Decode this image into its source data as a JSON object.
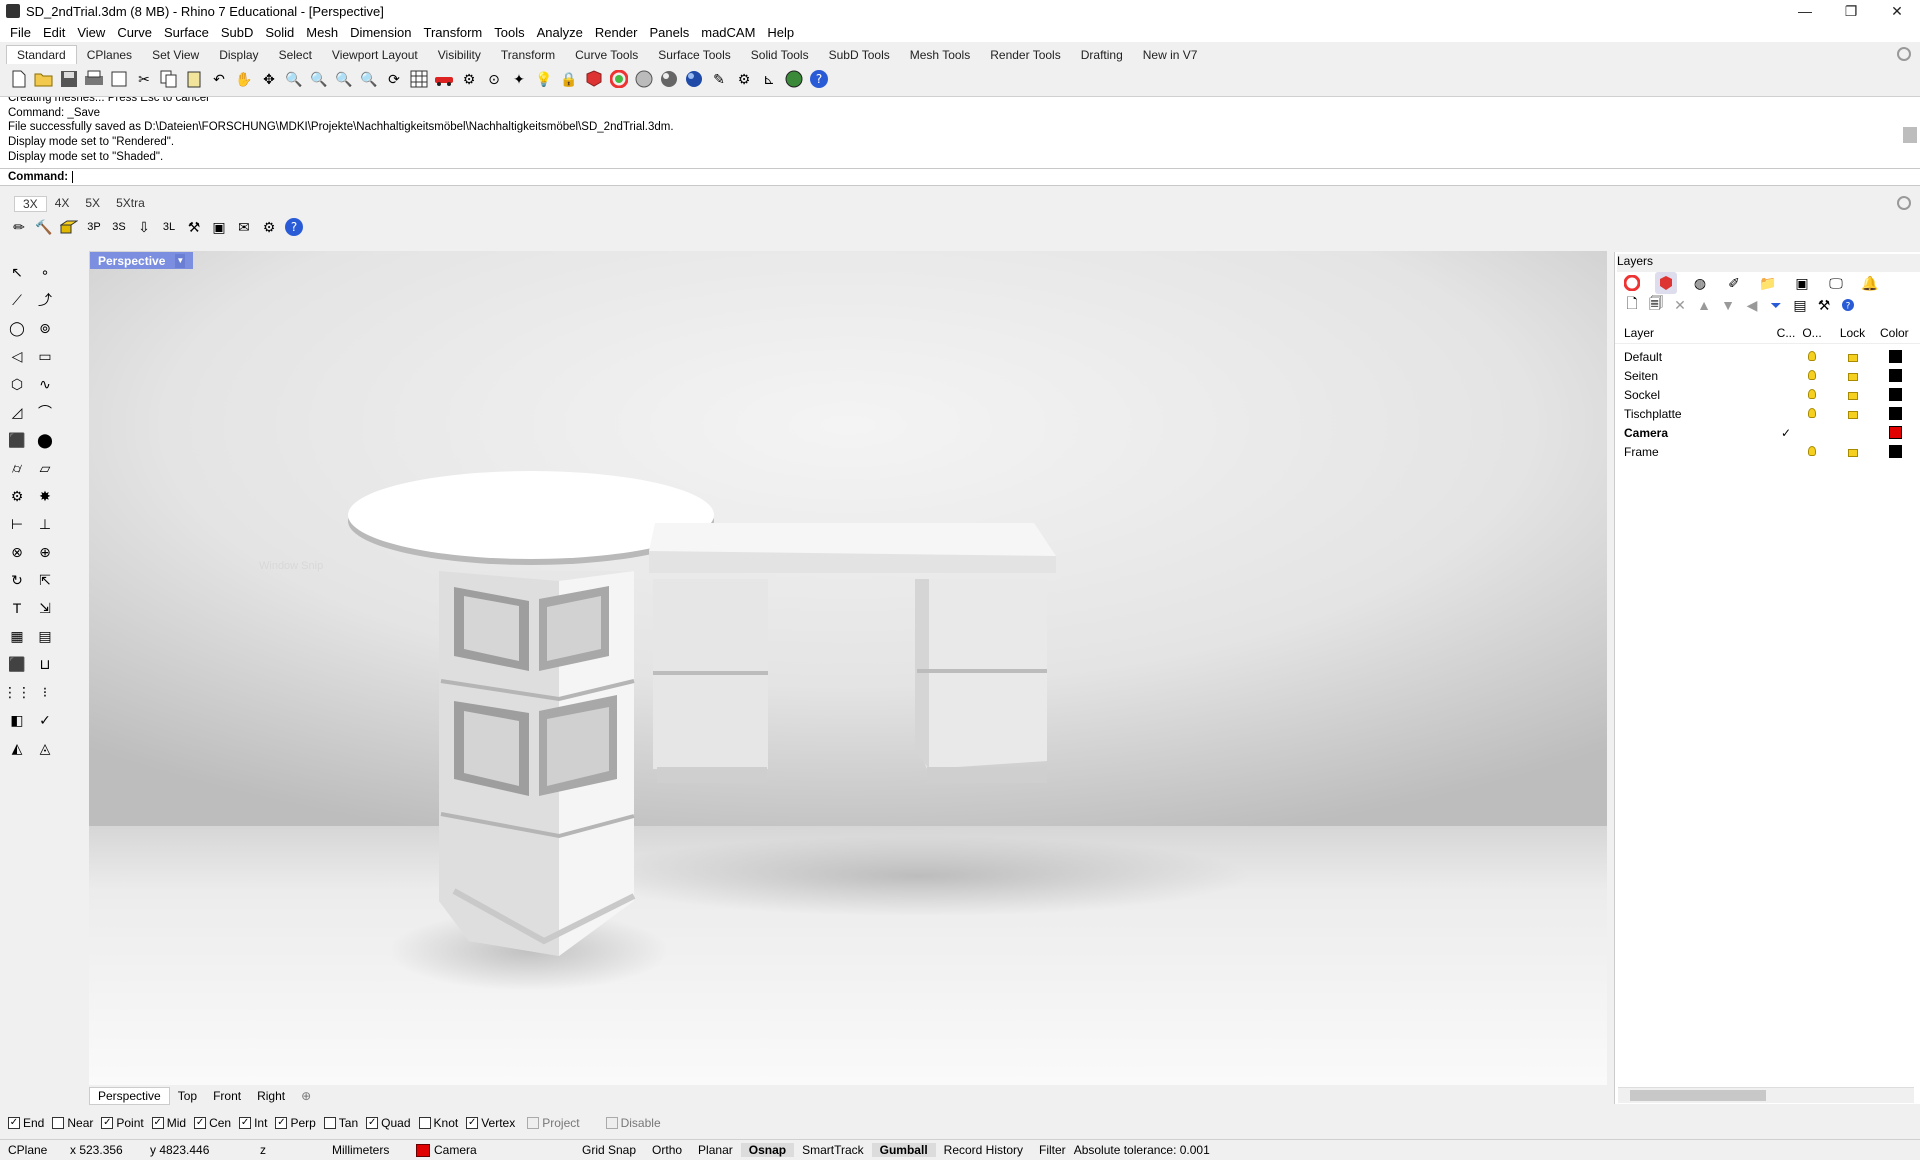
{
  "window": {
    "title": "SD_2ndTrial.3dm (8 MB) - Rhino 7 Educational - [Perspective]",
    "controls": [
      "—",
      "❐",
      "✕"
    ]
  },
  "menu": [
    "File",
    "Edit",
    "View",
    "Curve",
    "Surface",
    "SubD",
    "Solid",
    "Mesh",
    "Dimension",
    "Transform",
    "Tools",
    "Analyze",
    "Render",
    "Panels",
    "madCAM",
    "Help"
  ],
  "toolbar_tabs": [
    "Standard",
    "CPlanes",
    "Set View",
    "Display",
    "Select",
    "Viewport Layout",
    "Visibility",
    "Transform",
    "Curve Tools",
    "Surface Tools",
    "Solid Tools",
    "SubD Tools",
    "Mesh Tools",
    "Render Tools",
    "Drafting",
    "New in V7"
  ],
  "command_history": [
    "Creating meshes... Press Esc to cancel",
    "Command: _Save",
    "File successfully saved as D:\\Dateien\\FORSCHUNG\\MDKI\\Projekte\\Nachhaltigkeitsmöbel\\Nachhaltigkeitsmöbel\\SD_2ndTrial.3dm.",
    "Display mode set to \"Rendered\".",
    "Display mode set to \"Shaded\"."
  ],
  "command_prompt": "Command:",
  "plugin_tabs": [
    "3X",
    "4X",
    "5X",
    "5Xtra"
  ],
  "viewport": {
    "label": "Perspective",
    "watermark": "Window Snip"
  },
  "viewport_tabs": [
    "Perspective",
    "Top",
    "Front",
    "Right",
    "⊕"
  ],
  "osnap": [
    {
      "label": "End",
      "checked": true,
      "disabled": false
    },
    {
      "label": "Near",
      "checked": false,
      "disabled": false
    },
    {
      "label": "Point",
      "checked": true,
      "disabled": false
    },
    {
      "label": "Mid",
      "checked": true,
      "disabled": false
    },
    {
      "label": "Cen",
      "checked": true,
      "disabled": false
    },
    {
      "label": "Int",
      "checked": true,
      "disabled": false
    },
    {
      "label": "Perp",
      "checked": true,
      "disabled": false
    },
    {
      "label": "Tan",
      "checked": false,
      "disabled": false
    },
    {
      "label": "Quad",
      "checked": true,
      "disabled": false
    },
    {
      "label": "Knot",
      "checked": false,
      "disabled": false
    },
    {
      "label": "Vertex",
      "checked": true,
      "disabled": false
    },
    {
      "label": "Project",
      "checked": false,
      "disabled": true
    },
    {
      "label": "Disable",
      "checked": false,
      "disabled": true
    }
  ],
  "status": {
    "cplane": "CPlane",
    "x": "x 523.356",
    "y": "y 4823.446",
    "z": "z",
    "units": "Millimeters",
    "layer": "Camera",
    "layer_color": "#e00000",
    "toggles": [
      "Grid Snap",
      "Ortho",
      "Planar",
      "Osnap",
      "SmartTrack",
      "Gumball",
      "Record History",
      "Filter"
    ],
    "active_toggles": [
      "Osnap",
      "Gumball"
    ],
    "tolerance": "Absolute tolerance: 0.001"
  },
  "layers_panel": {
    "title": "Layers",
    "columns": [
      "Layer",
      "C...",
      "O...",
      "Lock",
      "Color"
    ],
    "rows": [
      {
        "name": "Default",
        "current": false,
        "on": true,
        "locked": true,
        "color": "#000000"
      },
      {
        "name": "Seiten",
        "current": false,
        "on": true,
        "locked": true,
        "color": "#000000"
      },
      {
        "name": "Sockel",
        "current": false,
        "on": true,
        "locked": true,
        "color": "#000000"
      },
      {
        "name": "Tischplatte",
        "current": false,
        "on": true,
        "locked": true,
        "color": "#000000"
      },
      {
        "name": "Camera",
        "current": true,
        "on": false,
        "locked": false,
        "color": "#e00000"
      },
      {
        "name": "Frame",
        "current": false,
        "on": true,
        "locked": true,
        "color": "#000000"
      }
    ]
  },
  "icons": [
    "new-file-icon",
    "open-icon",
    "save-icon",
    "print-icon",
    "undo-icon",
    "pan-icon",
    "zoom-icon",
    "layer-icon",
    "render-icon",
    "help-icon"
  ]
}
